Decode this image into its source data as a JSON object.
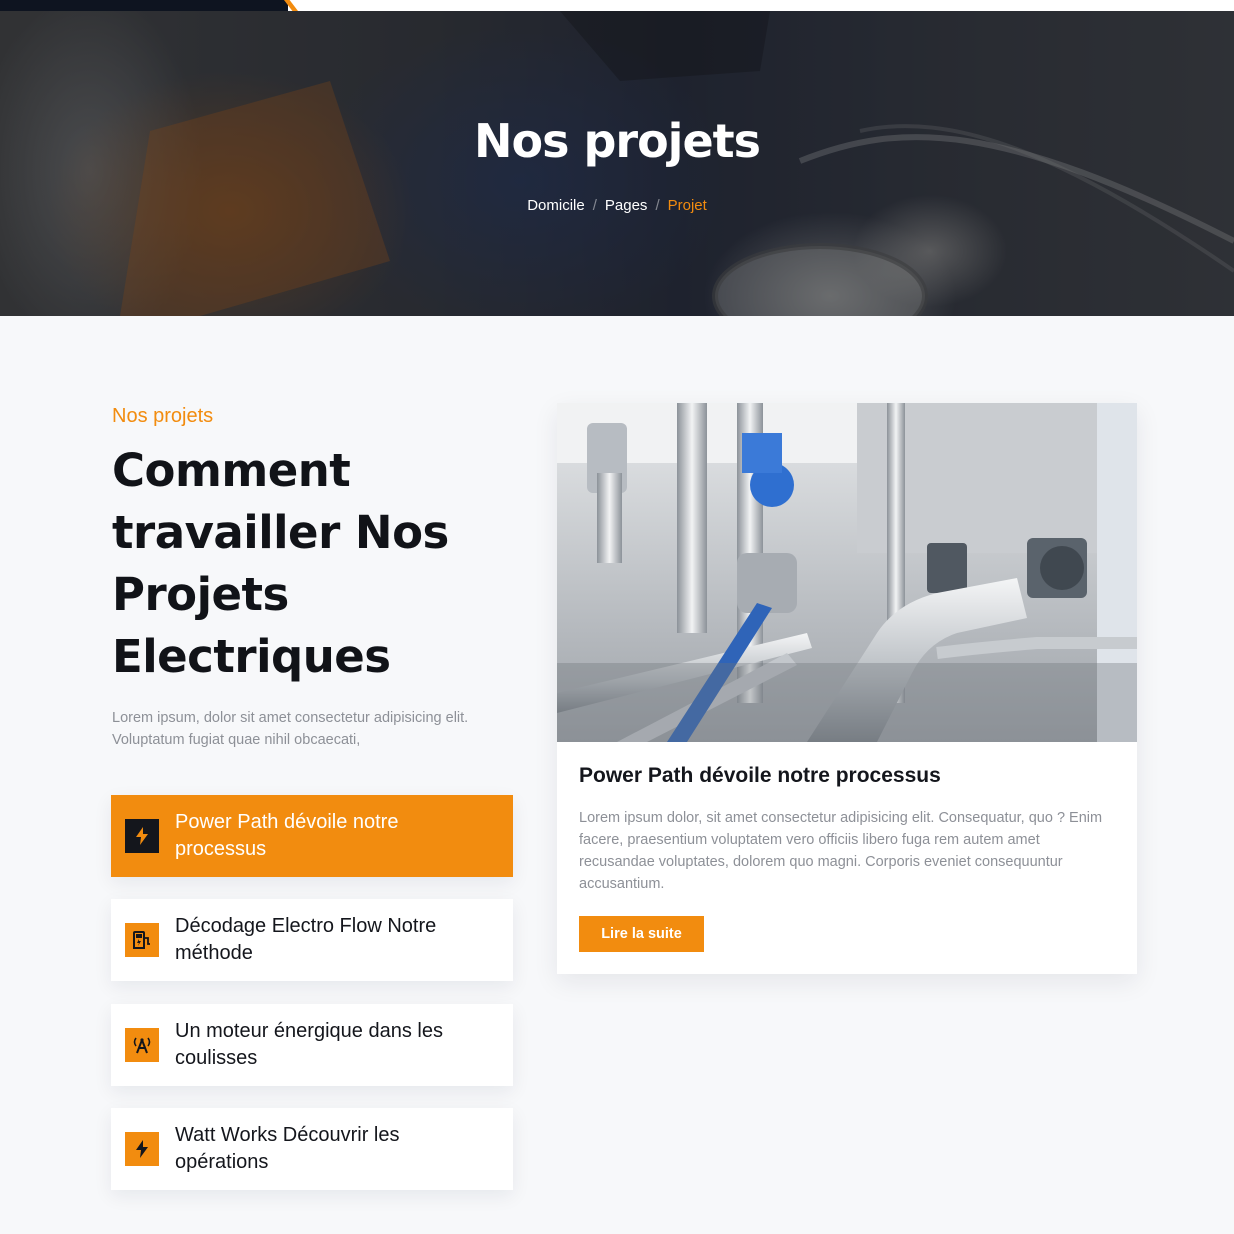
{
  "colors": {
    "accent": "#f28c0f",
    "dark": "#14161c",
    "muted_text": "#8d9097",
    "page_bg": "#f7f8fa"
  },
  "hero": {
    "title": "Nos projets",
    "breadcrumb": [
      {
        "label": "Domicile"
      },
      {
        "label": "Pages"
      },
      {
        "label": "Projet",
        "active": true
      }
    ],
    "separator": "/"
  },
  "section": {
    "eyebrow": "Nos projets",
    "heading": "Comment travailler Nos Projets Electriques",
    "intro": "Lorem ipsum, dolor sit amet consectetur adipisicing elit. Voluptatum fugiat quae nihil obcaecati,"
  },
  "tabs": [
    {
      "label": "Power Path dévoile notre processus",
      "icon": "lightning-icon",
      "active": true
    },
    {
      "label": "Décodage Electro Flow Notre méthode",
      "icon": "charging-station-icon",
      "active": false
    },
    {
      "label": "Un moteur énergique dans les coulisses",
      "icon": "antenna-signal-icon",
      "active": false
    },
    {
      "label": "Watt Works Découvrir les opérations",
      "icon": "lightning-icon",
      "active": false
    }
  ],
  "card": {
    "image": "industrial-piping-photo",
    "title": "Power Path dévoile notre processus",
    "text": "Lorem ipsum dolor, sit amet consectetur adipisicing elit. Consequatur, quo ? Enim facere, praesentium voluptatem vero officiis libero fuga rem autem amet recusandae voluptates, dolorem quo magni. Corporis eveniet consequuntur accusantium.",
    "button_label": "Lire la suite"
  }
}
